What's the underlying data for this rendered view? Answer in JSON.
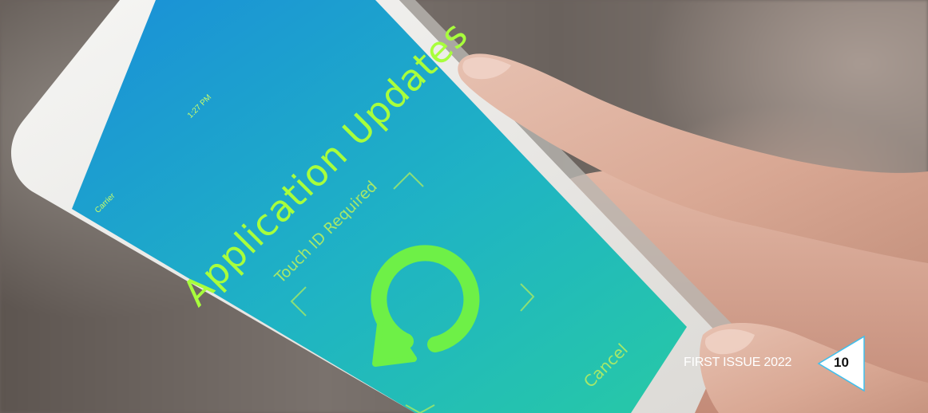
{
  "phone_screen": {
    "carrier": "Carrier",
    "time": "1:27 PM",
    "title": "Application Updates",
    "touch_id_label": "Touch ID Required",
    "cancel_label": "Cancel",
    "icon": "refresh-icon",
    "colors": {
      "gradient_top": "#1ea2d6",
      "gradient_bottom": "#23c4a8",
      "accent_green": "#72f34a"
    }
  },
  "badge": {
    "issue": "FIRST ISSUE 2022",
    "page_number": "10"
  }
}
